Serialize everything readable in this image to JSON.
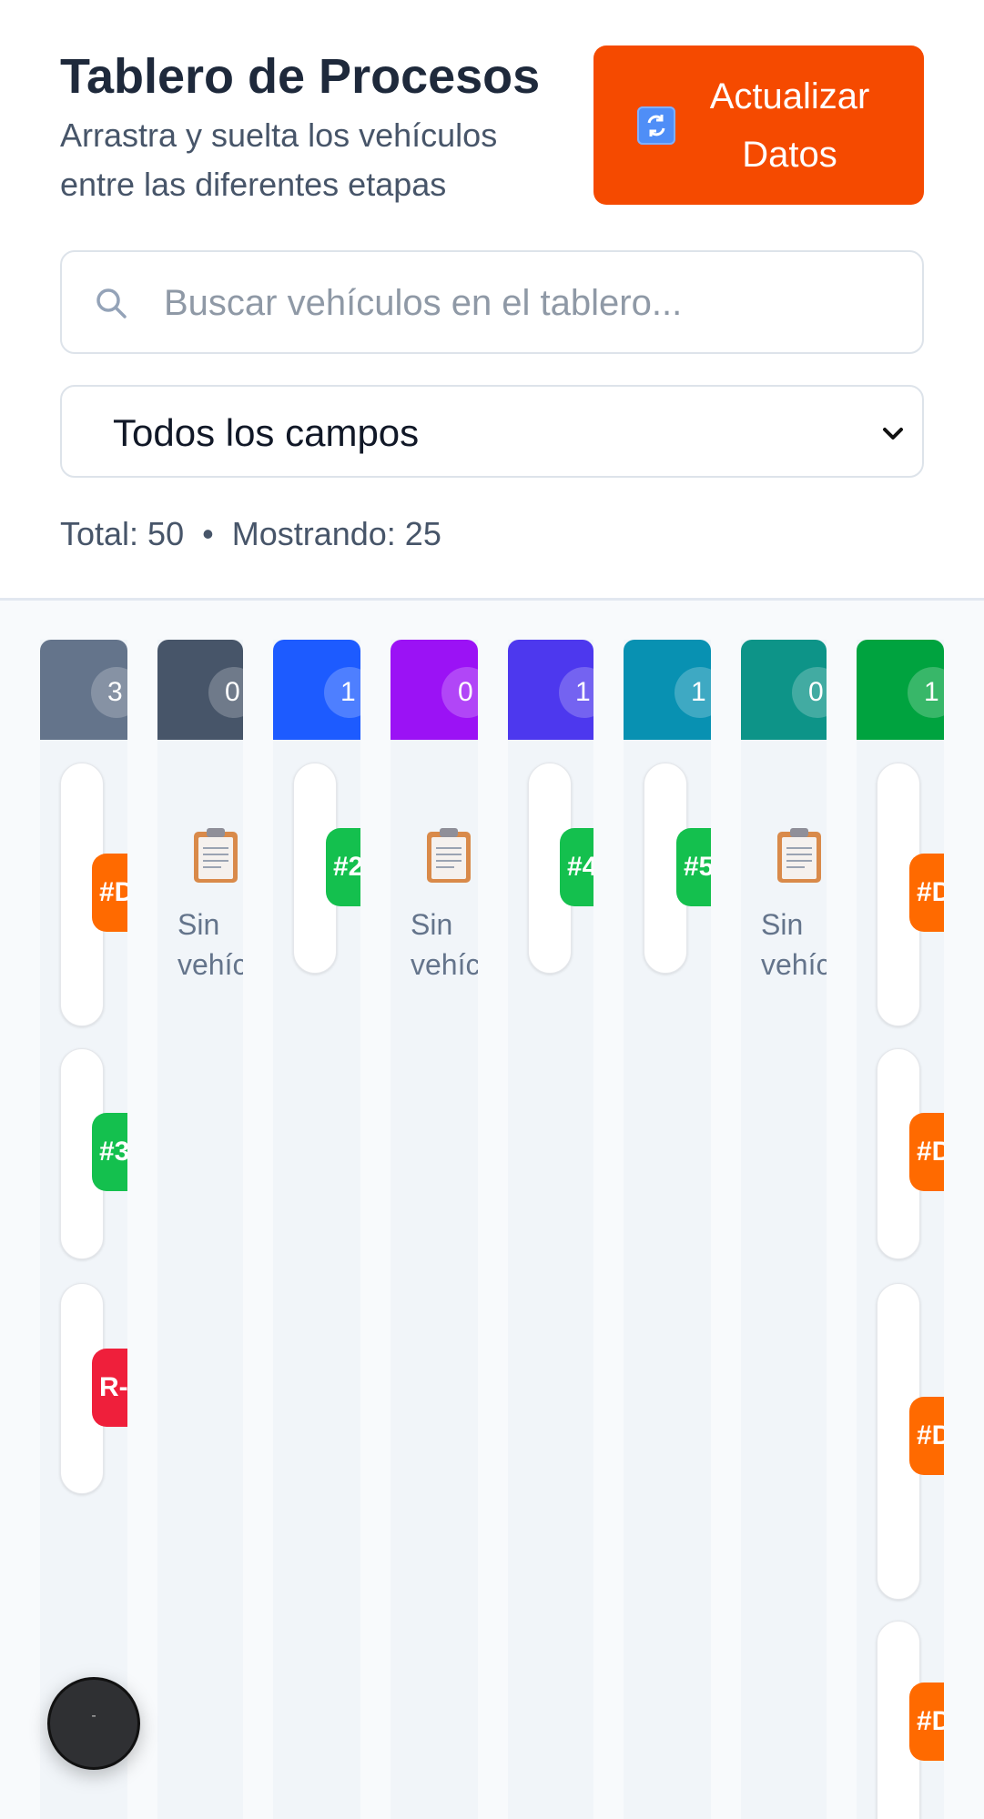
{
  "header": {
    "title": "Tablero de Procesos",
    "subtitle": "Arrastra y suelta los vehículos entre las diferentes etapas",
    "refresh_button": {
      "label": "Actualizar Datos",
      "icon": "refresh-icon"
    }
  },
  "search": {
    "placeholder": "Buscar vehículos en el tablero...",
    "icon": "search-icon"
  },
  "filter": {
    "selected": "Todos los campos"
  },
  "stats": {
    "total": "Total: 50",
    "separator": "•",
    "showing": "Mostrando: 25"
  },
  "columns": [
    {
      "color": "#64748b",
      "count": "3"
    },
    {
      "color": "#475569",
      "count": "0",
      "empty_text": "Sin vehículos"
    },
    {
      "color": "#1d5bff",
      "count": "1"
    },
    {
      "color": "#9b12f5",
      "count": "0",
      "empty_text": "Sin vehículos"
    },
    {
      "color": "#4d38ee",
      "count": "1"
    },
    {
      "color": "#0891b2",
      "count": "1"
    },
    {
      "color": "#0d9488",
      "count": "0",
      "empty_text": "Sin vehículos"
    },
    {
      "color": "#00a33f",
      "count": "1"
    }
  ],
  "cards": {
    "c1a": "#D",
    "c1b": "#3",
    "c1c": "R-",
    "c3a": "#2",
    "c5a": "#4",
    "c6a": "#5",
    "c8a": "#D",
    "c8b": "#D",
    "c8c": "#D",
    "c8d": "#D"
  },
  "fab": {
    "label": "-"
  }
}
